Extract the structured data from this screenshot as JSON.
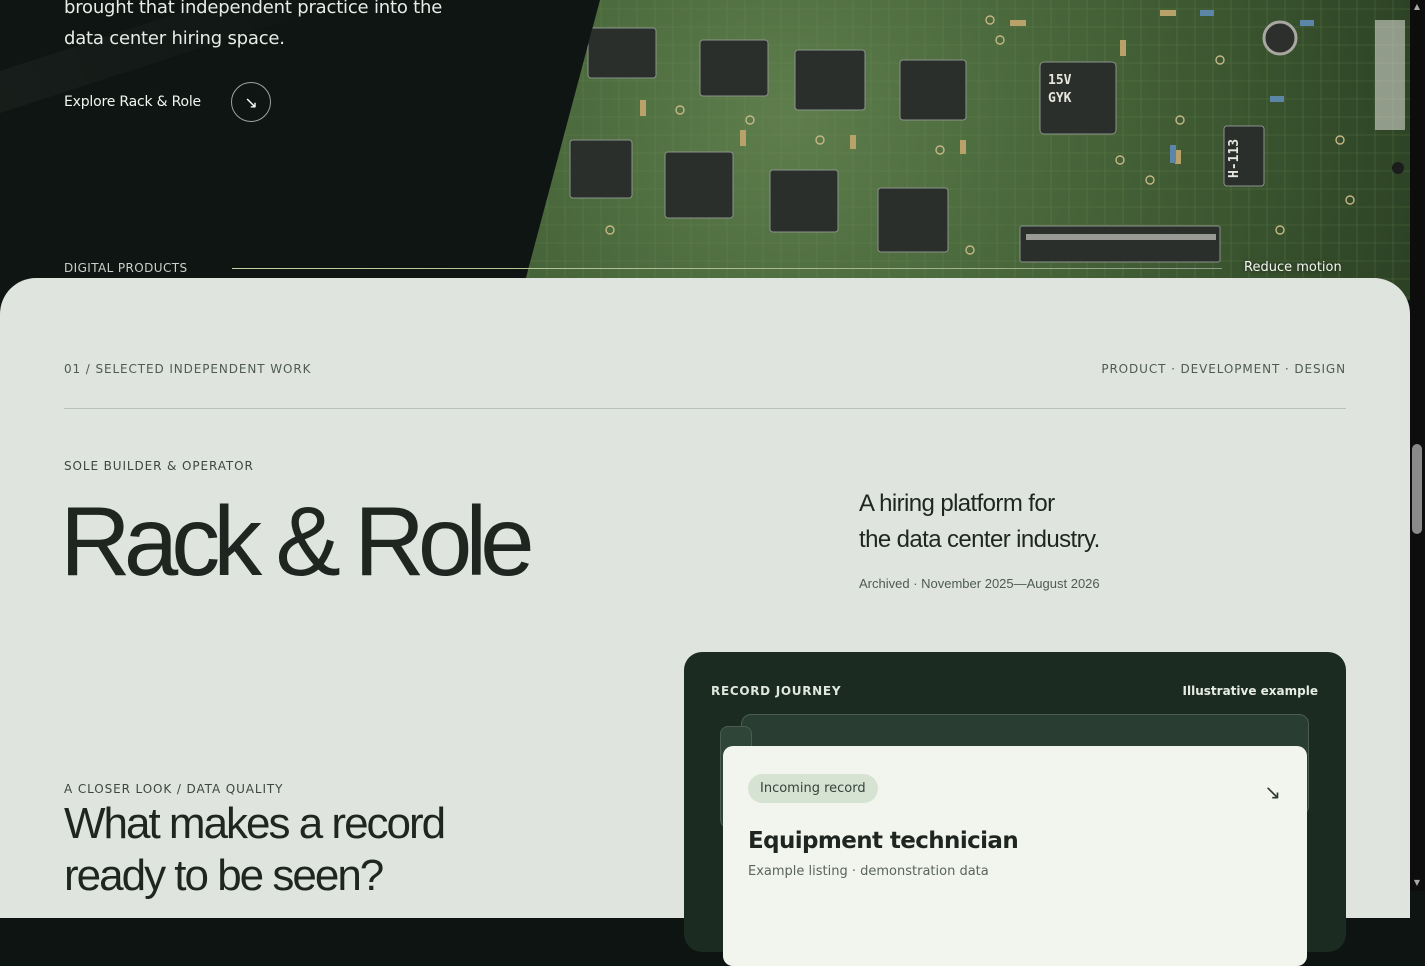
{
  "hero": {
    "text_line1": "brought that independent practice into the",
    "text_line2": "data center hiring space.",
    "explore_label": "Explore Rack & Role",
    "explore_icon": "arrow-down-right-icon",
    "digital_label": "DIGITAL PRODUCTS",
    "reduce_motion": "Reduce motion",
    "chip_labels": [
      "15V",
      "GYK",
      "H-113"
    ]
  },
  "section": {
    "kicker_left": "01 / SELECTED INDEPENDENT WORK",
    "kicker_right": "PRODUCT · DEVELOPMENT · DESIGN",
    "role": "SOLE BUILDER & OPERATOR",
    "title": "Rack & Role",
    "tagline_line1": "A hiring platform for",
    "tagline_line2": "the data center industry.",
    "archived": "Archived · November 2025—August 2026",
    "closer_kicker": "A CLOSER LOOK / DATA QUALITY",
    "closer_line1": "What makes a record",
    "closer_line2": "ready to be seen?"
  },
  "journey": {
    "kicker": "RECORD JOURNEY",
    "note": "Illustrative example",
    "pill": "Incoming record",
    "record_title": "Equipment technician",
    "record_sub": "Example listing · demonstration data",
    "arrow_icon": "arrow-down-right-icon"
  },
  "colors": {
    "hero_bg": "#0f1512",
    "panel_bg": "#dfe5de",
    "card_dark": "#1b2b22",
    "pill_bg": "#d7e3d2"
  }
}
